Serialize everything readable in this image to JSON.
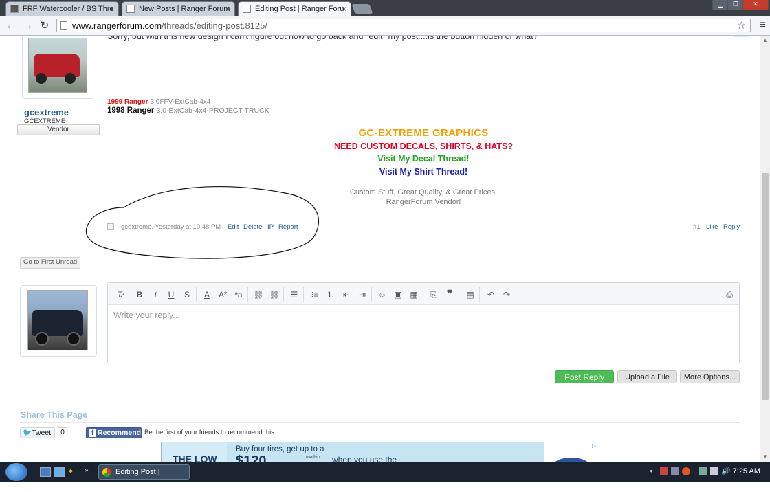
{
  "browser": {
    "tabs": [
      {
        "title": "FRF Watercooler / BS Thre",
        "close": "×"
      },
      {
        "title": "New Posts | Ranger Forum",
        "close": "×"
      },
      {
        "title": "Editing Post | Ranger Foru",
        "close": "×"
      }
    ],
    "url_host": "www.rangerforum.com",
    "url_path": "/threads/editing-post.8125/"
  },
  "post": {
    "text": "Sorry, but with this new design I can't figure out how to go back and \"edit\" my post....is the button hidden or what?",
    "author": "gcextreme",
    "author_title": "GCEXTREME",
    "author_badge": "Vendor",
    "sig": {
      "line1_year": "1999 Ranger",
      "line1_spec": "3.0FFV-ExtCab-4x4",
      "line2_year": "1998 Ranger",
      "line2_spec": "3.0-ExtCab-4x4-PROJECT TRUCK",
      "brand": "GC-EXTREME GRAPHICS",
      "need": "NEED CUSTOM DECALS, SHIRTS, & HATS?",
      "decal": "Visit My Decal Thread!",
      "shirt": "Visit My Shirt Thread!",
      "tag1": "Custom Stuff, Great Quality, & Great Prices!",
      "tag2": "RangerForum Vendor!"
    },
    "meta": "gcextreme, Yesterday at 10:48 PM",
    "actions": {
      "edit": "Edit",
      "delete": "Delete",
      "ip": "IP",
      "report": "Report"
    },
    "number": "#1",
    "like": "Like",
    "reply": "Reply"
  },
  "go_first_unread": "Go to First Unread",
  "editor": {
    "placeholder": "Write your reply...",
    "post_reply": "Post Reply",
    "upload": "Upload a File",
    "more_options": "More Options..."
  },
  "share": {
    "title": "Share This Page",
    "tweet": "Tweet",
    "tweet_count": "0",
    "recommend": "Recommend",
    "fb_text": "Be the first of your friends to recommend this."
  },
  "ad": {
    "line1": "Buy four tires, get up to a",
    "amount": "$120",
    "mail_in": "mail-in",
    "line2": "when you use the",
    "brand": "THE LOW"
  },
  "taskbar": {
    "window": "Editing Post | Range...",
    "clock": "7:25 AM"
  },
  "colors": {
    "accent_blue": "#1d5894",
    "post_reply_green": "#4cbd54",
    "brand_orange": "#f2a000"
  }
}
